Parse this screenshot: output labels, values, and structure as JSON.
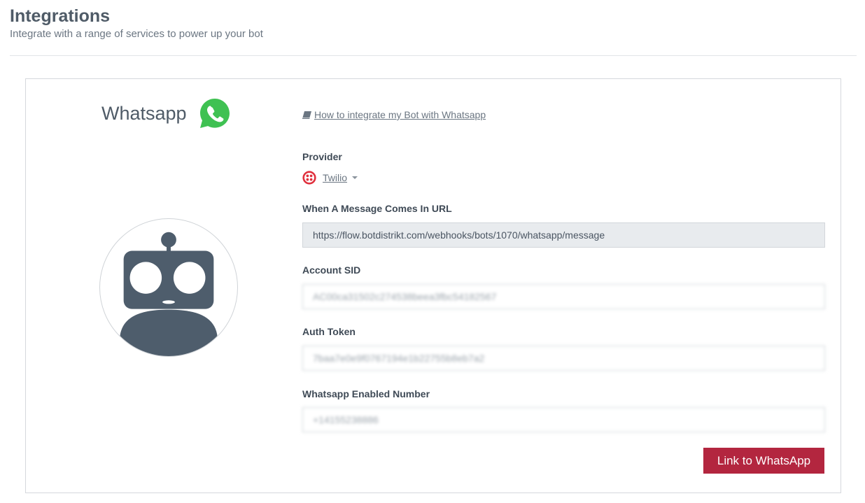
{
  "header": {
    "title": "Integrations",
    "subtitle": "Integrate with a range of services to power up your bot"
  },
  "integration": {
    "name": "Whatsapp",
    "logo_icon": "whatsapp-icon",
    "guide_link": "How to integrate my Bot with Whatsapp",
    "bot_avatar_icon": "robot-avatar-icon"
  },
  "form": {
    "provider": {
      "label": "Provider",
      "value": "Twilio",
      "icon": "twilio-icon"
    },
    "webhook_url": {
      "label": "When A Message Comes In URL",
      "value": "https://flow.botdistrikt.com/webhooks/bots/1070/whatsapp/message"
    },
    "account_sid": {
      "label": "Account SID",
      "value": "AC00ca31502c274538beea3fbc54182567"
    },
    "auth_token": {
      "label": "Auth Token",
      "value": "7baa7e0e9f0767194e1b22755b8eb7a2"
    },
    "enabled_number": {
      "label": "Whatsapp Enabled Number",
      "value": "+14155238886"
    },
    "submit_label": "Link to WhatsApp"
  },
  "colors": {
    "primary_button": "#b3263f",
    "whatsapp_green": "#3fc152",
    "twilio_red": "#e0303d",
    "robot_slate": "#4e5d6c"
  }
}
